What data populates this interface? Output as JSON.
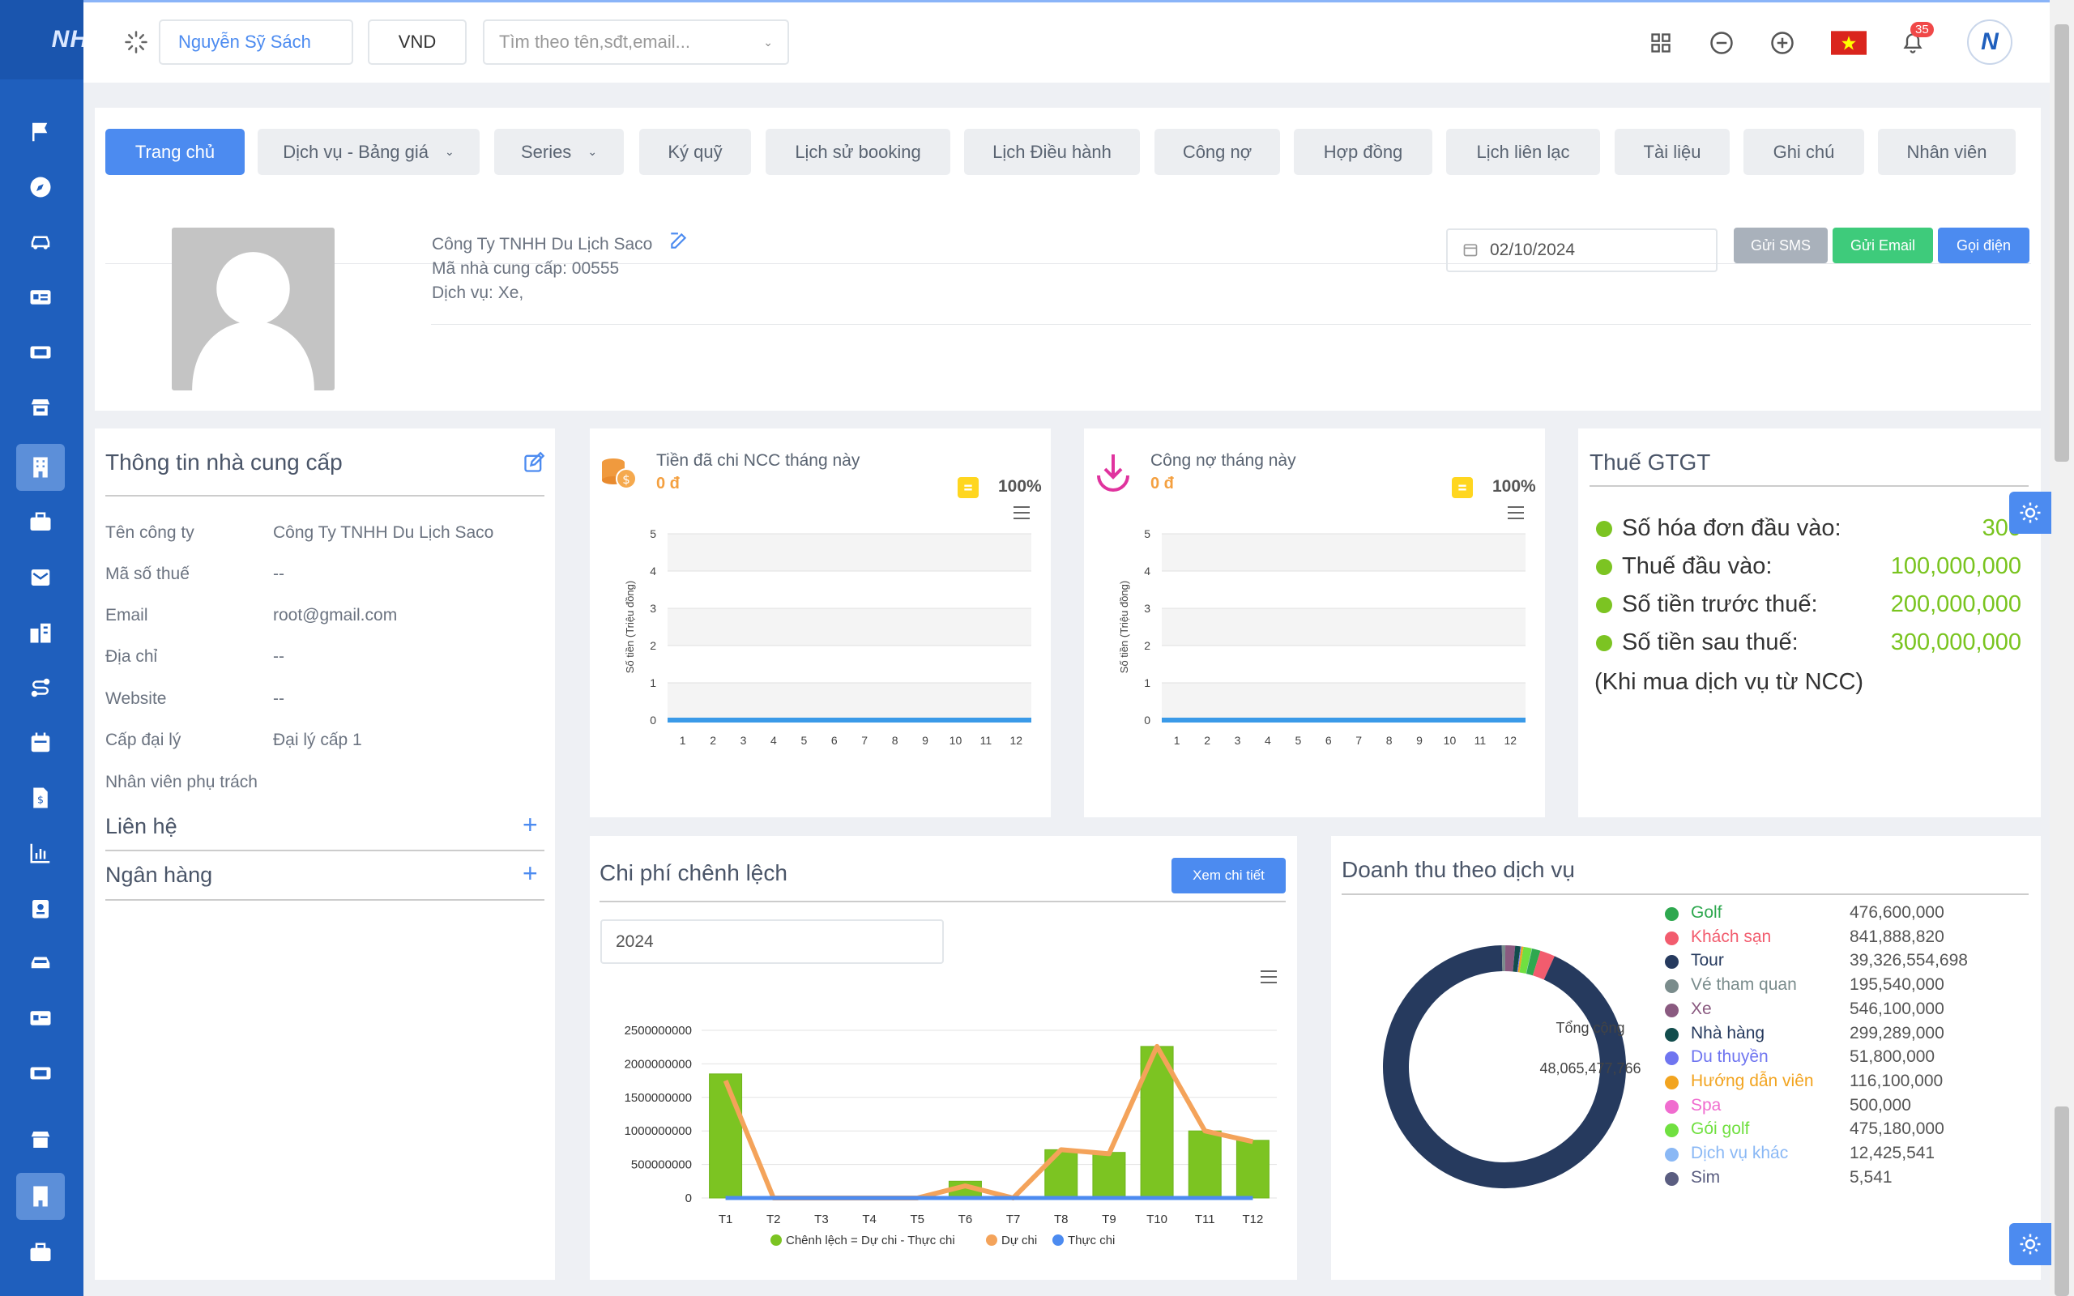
{
  "topbar": {
    "user_name": "Nguyễn Sỹ Sách",
    "currency": "VND",
    "search_placeholder": "Tìm theo tên,sđt,email...",
    "notification_count": "35"
  },
  "tabs": [
    {
      "label": "Trang chủ",
      "active": true
    },
    {
      "label": "Dịch vụ - Bảng giá",
      "dropdown": true
    },
    {
      "label": "Series",
      "dropdown": true
    },
    {
      "label": "Ký quỹ"
    },
    {
      "label": "Lịch sử booking"
    },
    {
      "label": "Lịch Điều hành"
    },
    {
      "label": "Công nợ"
    },
    {
      "label": "Hợp đồng"
    },
    {
      "label": "Lịch liên lạc"
    },
    {
      "label": "Tài liệu"
    },
    {
      "label": "Ghi chú"
    },
    {
      "label": "Nhân viên"
    }
  ],
  "profile": {
    "company": "Công Ty TNHH Du Lịch Saco",
    "supplier_code": "Mã nhà cung cấp: 00555",
    "services": "Dịch vụ: Xe,",
    "date": "02/10/2024",
    "sms_label": "Gửi SMS",
    "email_label": "Gửi Email",
    "call_label": "Gọi điện"
  },
  "supplier_info": {
    "title": "Thông tin nhà cung cấp",
    "rows": [
      {
        "label": "Tên công ty",
        "value": "Công Ty TNHH Du Lịch Saco"
      },
      {
        "label": "Mã số thuế",
        "value": "--"
      },
      {
        "label": "Email",
        "value": "root@gmail.com"
      },
      {
        "label": "Địa chỉ",
        "value": "--"
      },
      {
        "label": "Website",
        "value": "--"
      },
      {
        "label": "Cấp đại lý",
        "value": "Đại lý cấp 1"
      },
      {
        "label": "Nhân viên phụ trách",
        "value": ""
      }
    ],
    "contacts_label": "Liên hệ",
    "banks_label": "Ngân hàng"
  },
  "paid_card": {
    "title": "Tiền đã chi NCC tháng này",
    "amount": "0 đ",
    "percent": "100%"
  },
  "debt_card": {
    "title": "Công nợ tháng này",
    "amount": "0 đ",
    "percent": "100%"
  },
  "tax": {
    "title": "Thuế GTGT",
    "rows": [
      {
        "label": "Số hóa đơn đầu vào:",
        "value": "300"
      },
      {
        "label": "Thuế đầu vào:",
        "value": "100,000,000"
      },
      {
        "label": "Số tiền trước thuế:",
        "value": "200,000,000"
      },
      {
        "label": "Số tiền sau thuế:",
        "value": "300,000,000"
      }
    ],
    "note": "(Khi mua dịch vụ từ NCC)"
  },
  "cost_diff": {
    "title": "Chi phí chênh lệch",
    "detail_label": "Xem chi tiết",
    "year": "2024"
  },
  "revenue": {
    "title": "Doanh thu theo dịch vụ",
    "center_label": "Tổng cộng",
    "center_value": "48,065,477,766"
  },
  "chart_data": [
    {
      "type": "line",
      "ylabel": "Số tiền (Triệu đồng)",
      "x": [
        "1",
        "2",
        "3",
        "4",
        "5",
        "6",
        "7",
        "8",
        "9",
        "10",
        "11",
        "12"
      ],
      "ylim": [
        0,
        5
      ],
      "yticks": [
        "0",
        "1",
        "2",
        "3",
        "4",
        "5"
      ],
      "series": [
        {
          "values": [
            0,
            0,
            0,
            0,
            0,
            0,
            0,
            0,
            0,
            0,
            0,
            0
          ],
          "color": "#3a9ae8"
        }
      ]
    },
    {
      "type": "line",
      "ylabel": "Số tiền (Triệu đồng)",
      "x": [
        "1",
        "2",
        "3",
        "4",
        "5",
        "6",
        "7",
        "8",
        "9",
        "10",
        "11",
        "12"
      ],
      "ylim": [
        0,
        5
      ],
      "yticks": [
        "0",
        "1",
        "2",
        "3",
        "4",
        "5"
      ],
      "series": [
        {
          "values": [
            0,
            0,
            0,
            0,
            0,
            0,
            0,
            0,
            0,
            0,
            0,
            0
          ],
          "color": "#3a9ae8"
        }
      ]
    },
    {
      "type": "bar",
      "categories": [
        "T1",
        "T2",
        "T3",
        "T4",
        "T5",
        "T6",
        "T7",
        "T8",
        "T9",
        "T10",
        "T11",
        "T12"
      ],
      "ylim": [
        0,
        2500000000
      ],
      "yticks": [
        "0",
        "500000000",
        "1000000000",
        "1500000000",
        "2000000000",
        "2500000000"
      ],
      "series": [
        {
          "name": "Chênh lệch = Dự chi - Thực chi",
          "type": "bar",
          "color": "#7cc422",
          "values": [
            1850000000,
            0,
            0,
            0,
            0,
            250000000,
            0,
            720000000,
            680000000,
            2260000000,
            1000000000,
            860000000
          ]
        },
        {
          "name": "Dự chi",
          "type": "line",
          "color": "#f4a35a",
          "values": [
            1750000000,
            0,
            0,
            0,
            0,
            180000000,
            0,
            720000000,
            660000000,
            2260000000,
            1000000000,
            840000000
          ]
        },
        {
          "name": "Thực chi",
          "type": "line",
          "color": "#4c8bf0",
          "values": [
            0,
            0,
            0,
            0,
            0,
            0,
            0,
            0,
            0,
            0,
            0,
            0
          ]
        }
      ]
    },
    {
      "type": "pie",
      "categories": [
        "Golf",
        "Khách sạn",
        "Tour",
        "Vé tham quan",
        "Xe",
        "Nhà hàng",
        "Du thuyền",
        "Hướng dẫn viên",
        "Spa",
        "Gói golf",
        "Dịch vụ khác",
        "Sim"
      ],
      "values": [
        476600000,
        841888820,
        39326554698,
        195540000,
        546100000,
        299289000,
        51800000,
        116100000,
        500000,
        475180000,
        12425541,
        5541
      ],
      "labels": [
        "476,600,000",
        "841,888,820",
        "39,326,554,698",
        "195,540,000",
        "546,100,000",
        "299,289,000",
        "51,800,000",
        "116,100,000",
        "500,000",
        "475,180,000",
        "12,425,541",
        "5,541"
      ],
      "colors": [
        "#2ea84f",
        "#f25c6e",
        "#263a5e",
        "#7a8c8c",
        "#8a5a80",
        "#124d4d",
        "#6f75f0",
        "#f2a420",
        "#f06ccf",
        "#70e040",
        "#8ab8f5",
        "#5a5d80"
      ],
      "title": "Tổng cộng"
    }
  ]
}
